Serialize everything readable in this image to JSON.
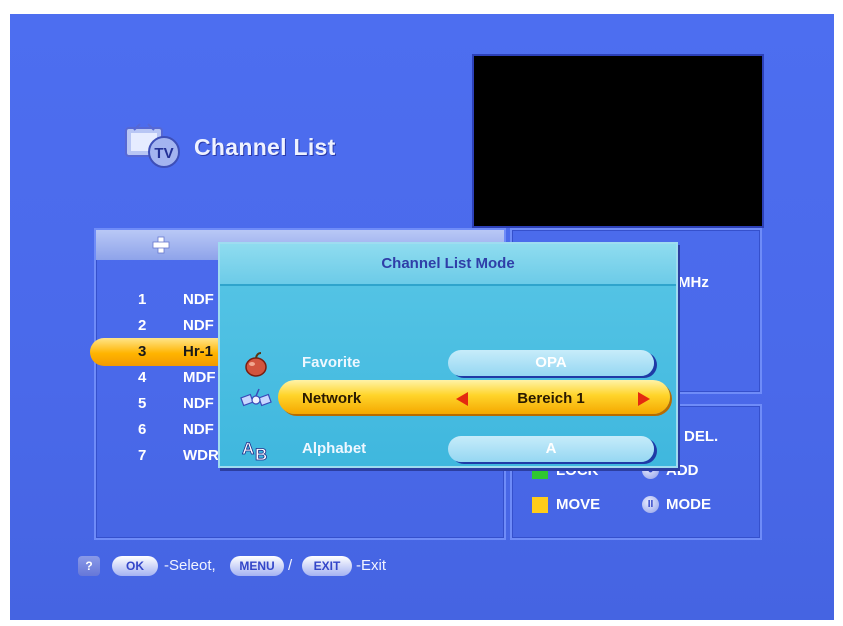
{
  "header": {
    "title": "Channel List",
    "icon_text": "TV"
  },
  "channel_list": {
    "items": [
      {
        "num": "1",
        "name": "NDF",
        "selected": false
      },
      {
        "num": "2",
        "name": "NDF",
        "selected": false
      },
      {
        "num": "3",
        "name": "Hr-1",
        "selected": true
      },
      {
        "num": "4",
        "name": "MDF",
        "selected": false
      },
      {
        "num": "5",
        "name": "NDF",
        "selected": false
      },
      {
        "num": "6",
        "name": "NDF",
        "selected": false
      },
      {
        "num": "7",
        "name": "WDR Köln",
        "selected": false
      }
    ]
  },
  "info": {
    "freq_unit": "MHz"
  },
  "legend": {
    "del_label": "DEL.",
    "lock_label": "LOCK",
    "add_label": "ADD",
    "move_label": "MOVE",
    "mode_label": "MODE",
    "colors": {
      "lock": "#2fc82f",
      "move": "#ffcc1a"
    }
  },
  "modal": {
    "title": "Channel List Mode",
    "options": {
      "favorite": {
        "label": "Favorite",
        "value": "OPA",
        "icon": "apple-icon"
      },
      "network": {
        "label": "Network",
        "value": "Bereich 1",
        "icon": "satellite-icon",
        "selected": true
      },
      "alphabet": {
        "label": "Alphabet",
        "value": "A",
        "icon": "ab-letters-icon"
      }
    }
  },
  "help": {
    "help_icon": "?",
    "ok_key": "OK",
    "ok_text": "-Seleot,",
    "menu_key": "MENU",
    "separator": "/",
    "exit_key": "EXIT",
    "exit_text": "-Exit"
  },
  "colors": {
    "background": "#4a69ea",
    "selection": "#ffb400",
    "modal": "#3fb7de"
  }
}
